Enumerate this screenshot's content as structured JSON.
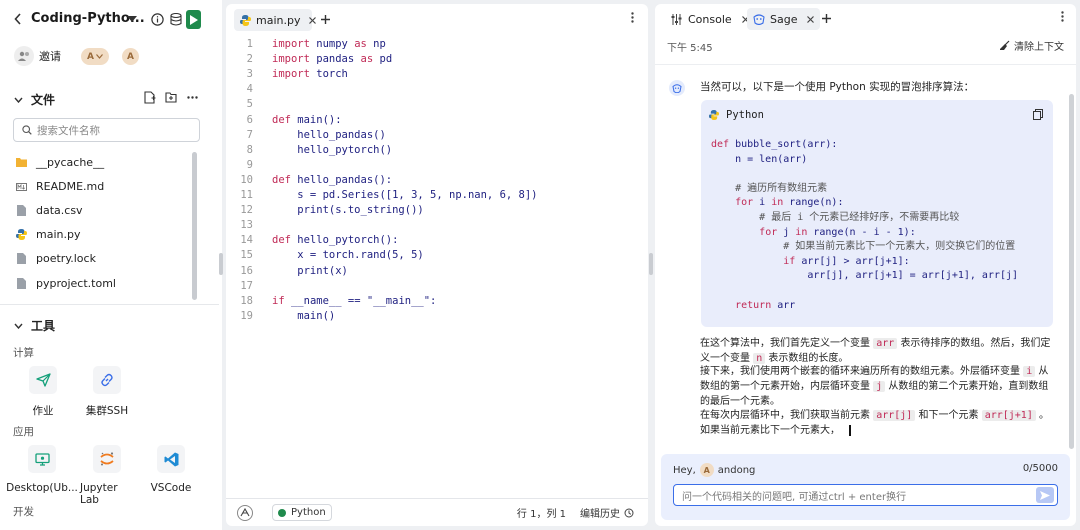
{
  "sidebar": {
    "project_title": "Coding-Pytho...",
    "invite_label": "邀请",
    "user_badge_1": "A",
    "user_badge_2": "A",
    "files_header": "文件",
    "search_placeholder": "搜索文件名称",
    "files": [
      {
        "name": "__pycache__",
        "icon": "folder-icon"
      },
      {
        "name": "README.md",
        "icon": "markdown-icon"
      },
      {
        "name": "data.csv",
        "icon": "file-icon"
      },
      {
        "name": "main.py",
        "icon": "python-icon"
      },
      {
        "name": "poetry.lock",
        "icon": "file-icon"
      },
      {
        "name": "pyproject.toml",
        "icon": "file-icon"
      }
    ],
    "tools_header": "工具",
    "compute_label": "计算",
    "compute_tools": [
      {
        "label": "作业",
        "icon": "send-icon"
      },
      {
        "label": "集群SSH",
        "icon": "link-icon"
      }
    ],
    "apps_label": "应用",
    "apps": [
      {
        "label": "Desktop(Ub...",
        "icon": "desktop-icon"
      },
      {
        "label": "Jupyter Lab",
        "icon": "jupyter-icon"
      },
      {
        "label": "VSCode",
        "icon": "vscode-icon"
      }
    ],
    "dev_label": "开发"
  },
  "editor": {
    "tab_label": "main.py",
    "code_lines": [
      "import numpy as np",
      "import pandas as pd",
      "import torch",
      "",
      "",
      "def main():",
      "    hello_pandas()",
      "    hello_pytorch()",
      "",
      "def hello_pandas():",
      "    s = pd.Series([1, 3, 5, np.nan, 6, 8])",
      "    print(s.to_string())",
      "",
      "def hello_pytorch():",
      "    x = torch.rand(5, 5)",
      "    print(x)",
      "",
      "if __name__ == \"__main__\":",
      "    main()"
    ],
    "language": "Python",
    "cursor_position": "行 1，列 1",
    "history_label": "编辑历史"
  },
  "chat": {
    "tabs": [
      {
        "label": "Console",
        "icon": "sliders-icon"
      },
      {
        "label": "Sage",
        "icon": "sage-icon"
      }
    ],
    "time": "下午 5:45",
    "clear_label": "清除上下文",
    "intro": "当然可以，以下是一个使用 Python 实现的冒泡排序算法：",
    "code_lang": "Python",
    "code_lines": [
      "def bubble_sort(arr):",
      "    n = len(arr)",
      "",
      "    # 遍历所有数组元素",
      "    for i in range(n):",
      "        # 最后 i 个元素已经排好序，不需要再比较",
      "        for j in range(n - i - 1):",
      "            # 如果当前元素比下一个元素大，则交换它们的位置",
      "            if arr[j] > arr[j+1]:",
      "                arr[j], arr[j+1] = arr[j+1], arr[j]",
      "",
      "    return arr"
    ],
    "para_1a": "在这个算法中，我们首先定义一个变量",
    "para_1_code": "arr",
    "para_1b": "表示待排序的数组。然后，我们定义一个变量",
    "para_1_code2": "n",
    "para_1c": "表示数组的长度。",
    "para_2a": "接下来，我们使用两个嵌套的循环来遍历所有的数组元素。外层循环变量",
    "para_2_code": "i",
    "para_2b": "从数组的第一个元素开始，内层循环变量",
    "para_2_code2": "j",
    "para_2c": "从数组的第二个元素开始，直到数组的最后一个元素。",
    "para_3a": "在每次内层循环中，我们获取当前元素",
    "para_3_code": "arr[j]",
    "para_3b": "和下一个元素",
    "para_3_code2": "arr[j+1]",
    "para_3c": "。如果当前元素比下一个元素大，",
    "greeting": "Hey,",
    "username": "andong",
    "char_count": "0/5000",
    "input_placeholder": "问一个代码相关的问题吧, 可通过ctrl + enter换行"
  }
}
